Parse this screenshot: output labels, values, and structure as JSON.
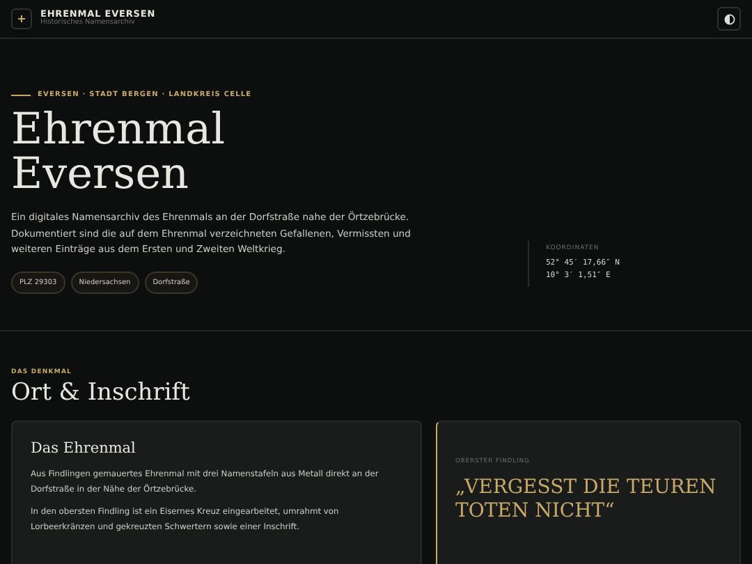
{
  "header": {
    "title": "EHRENMAL EVERSEN",
    "subtitle": "Historisches Namensarchiv"
  },
  "hero": {
    "eyebrow": "EVERSEN · STADT BERGEN · LANDKREIS CELLE",
    "title": "Ehrenmal Eversen",
    "intro": "Ein digitales Namensarchiv des Ehrenmals an der Dorfstraße nahe der Örtzebrücke. Dokumentiert sind die auf dem Ehrenmal verzeichneten Gefallenen, Vermissten und weiteren Einträge aus dem Ersten und Zweiten Weltkrieg.",
    "tags": [
      "PLZ 29303",
      "Niedersachsen",
      "Dorfstraße"
    ],
    "coordinates": {
      "label": "KOORDINATEN",
      "lines": [
        "52° 45′ 17,66″ N",
        "10° 3′ 1,51″ E"
      ]
    }
  },
  "section": {
    "eyebrow": "DAS DENKMAL",
    "title": "Ort & Inschrift",
    "card": {
      "title": "Das Ehrenmal",
      "paragraphs": [
        "Aus Findlingen gemauertes Ehrenmal mit drei Namenstafeln aus Metall direkt an der Dorfstraße in der Nähe der Örtzebrücke.",
        "In den obersten Findling ist ein Eisernes Kreuz eingearbeitet, umrahmt von Lorbeerkränzen und gekreuzten Schwertern sowie einer Inschrift."
      ]
    },
    "quote": {
      "label": "OBERSTER FINDLING",
      "text": "„VERGESST DIE TEUREN TOTEN NICHT“"
    }
  }
}
